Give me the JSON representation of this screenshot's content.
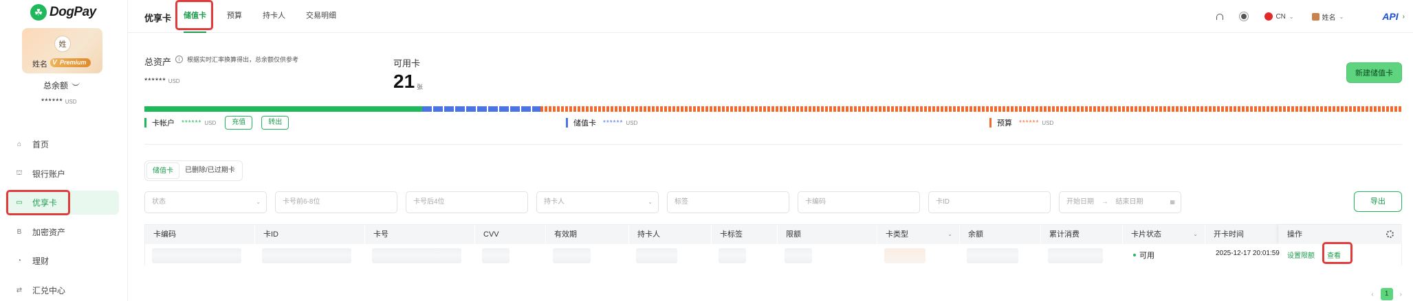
{
  "brand": {
    "name": "DogPay"
  },
  "profile": {
    "avatar_text": "姓",
    "name": "姓名",
    "tier": "Premium"
  },
  "balance": {
    "label": "总余额",
    "value": "******",
    "unit": "USD"
  },
  "sidebar": {
    "items": [
      {
        "label": "首页",
        "icon": "home-icon",
        "glyph": "⌂"
      },
      {
        "label": "银行账户",
        "icon": "bank-icon",
        "glyph": "⛫"
      },
      {
        "label": "优享卡",
        "icon": "card-icon",
        "glyph": "▭"
      },
      {
        "label": "加密资产",
        "icon": "bitcoin-icon",
        "glyph": "B"
      },
      {
        "label": "理财",
        "icon": "finance-icon",
        "glyph": "◔"
      },
      {
        "label": "汇兑中心",
        "icon": "exchange-icon",
        "glyph": "⇄"
      }
    ]
  },
  "header": {
    "title": "优享卡",
    "tabs": [
      "储值卡",
      "预算",
      "持卡人",
      "交易明细"
    ],
    "lang": "CN",
    "user": "姓名",
    "api": "API"
  },
  "summary": {
    "total_assets_label": "总资产",
    "total_assets_note": "根据实时汇率换算得出，总余额仅供参考",
    "total_assets_value": "******",
    "unit": "USD",
    "available_cards_label": "可用卡",
    "available_cards_count": "21",
    "available_cards_unit": "张",
    "new_card_button": "新建储值卡"
  },
  "distribution": [
    {
      "label": "卡帐户",
      "value": "******",
      "unit": "USD",
      "color": "#1fb85a"
    },
    {
      "label": "储值卡",
      "value": "******",
      "unit": "USD",
      "color": "#4b73e8"
    },
    {
      "label": "预算",
      "value": "******",
      "unit": "USD",
      "color": "#ef6a2e"
    }
  ],
  "account_actions": {
    "recharge": "充值",
    "transfer_out": "转出"
  },
  "list_tabs": [
    "储值卡",
    "已删除/已过期卡"
  ],
  "filters": {
    "status": "状态",
    "card_prefix": "卡号前6-8位",
    "card_suffix": "卡号后4位",
    "holder": "持卡人",
    "tag": "标签",
    "card_code": "卡编码",
    "card_id": "卡ID",
    "start_date": "开始日期",
    "end_date": "结束日期",
    "export": "导出"
  },
  "table": {
    "columns": [
      "卡编码",
      "卡ID",
      "卡号",
      "CVV",
      "有效期",
      "持卡人",
      "卡标签",
      "限额",
      "卡类型",
      "余额",
      "累计消费",
      "卡片状态",
      "开卡时间",
      "操作"
    ],
    "rows": [
      {
        "status": "可用",
        "open_time": "2025-12-17 20:01:59",
        "action_limit": "设置限额",
        "action_view": "查看"
      }
    ]
  },
  "pagination": {
    "current": "1"
  }
}
